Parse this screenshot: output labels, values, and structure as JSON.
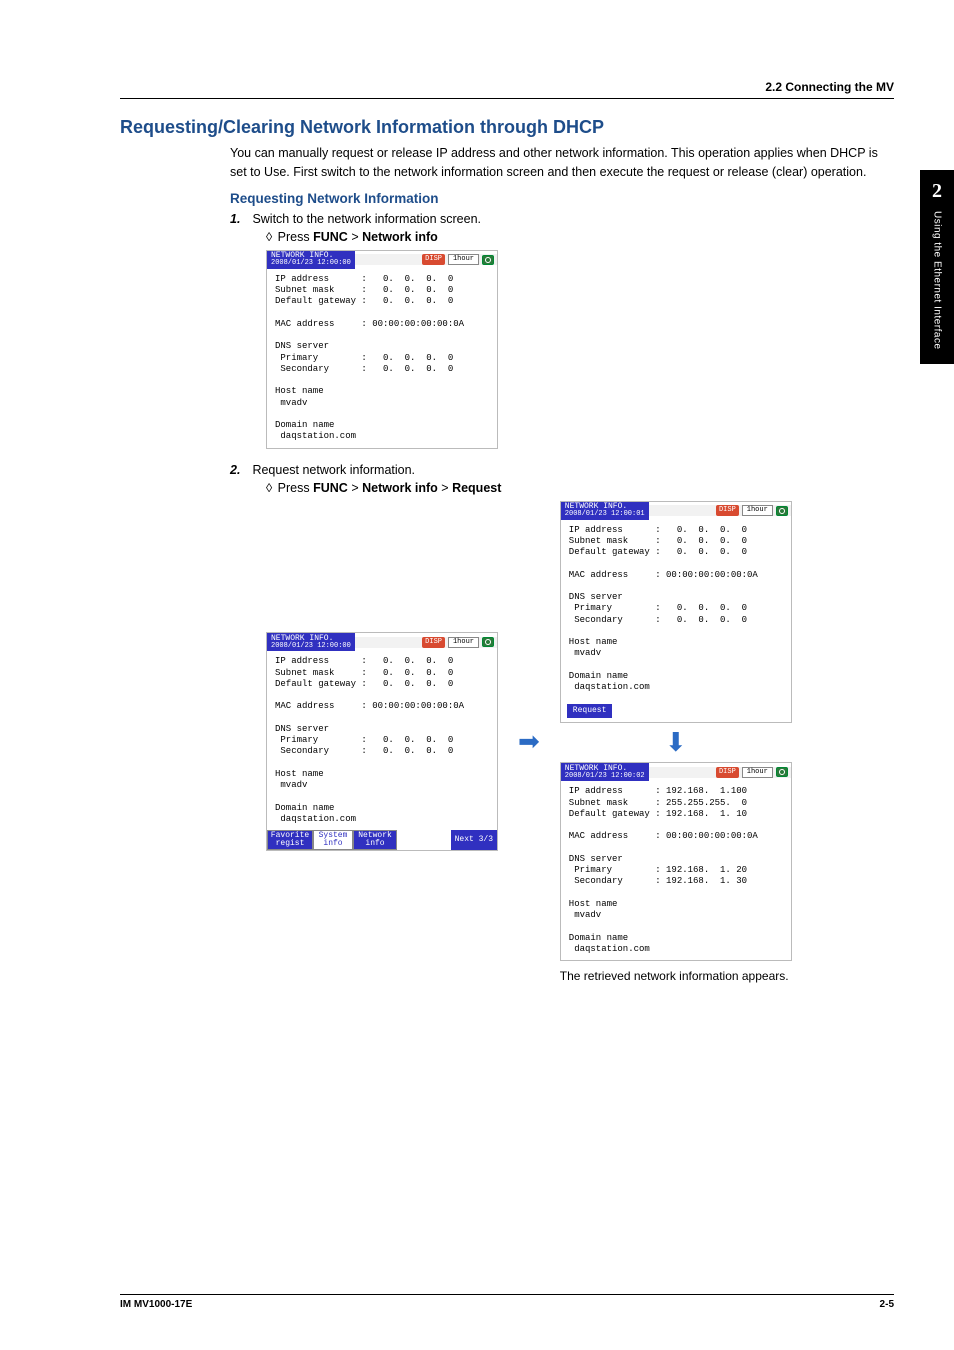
{
  "header": {
    "section": "2.2  Connecting the MV"
  },
  "title": "Requesting/Clearing Network Information through DHCP",
  "intro": "You can manually request or release IP address and other network information. This operation applies when DHCP is set to Use. First switch to the network information screen and then execute the request or release (clear) operation.",
  "sub1": "Requesting Network Information",
  "step1": {
    "num": "1.",
    "text": "Switch to the network information screen."
  },
  "bc1": {
    "prefix": "◊ Press ",
    "a": "FUNC",
    "sep": " > ",
    "b": "Network info"
  },
  "step2": {
    "num": "2.",
    "text": "Request network information."
  },
  "bc2": {
    "prefix": "◊ Press ",
    "a": "FUNC",
    "sep": " > ",
    "b": "Network info",
    "c": "Request"
  },
  "screen_zero": {
    "title": "NETWORK INFO.",
    "ts": "2008/01/23 12:00:00",
    "disp": "DISP",
    "hour": "1hour",
    "body": "IP address      :   0.  0.  0.  0\nSubnet mask     :   0.  0.  0.  0\nDefault gateway :   0.  0.  0.  0\n\nMAC address     : 00:00:00:00:00:0A\n\nDNS server\n Primary        :   0.  0.  0.  0\n Secondary      :   0.  0.  0.  0\n\nHost name\n mvadv\n\nDomain name\n daqstation.com"
  },
  "screen_zero_menu": {
    "ts": "2008/01/23 12:00:00",
    "btn1a": "Favorite",
    "btn1b": "regist",
    "btn2a": "System",
    "btn2b": "info",
    "btn3a": "Network",
    "btn3b": "info",
    "next": "Next 3/3"
  },
  "screen_zero_req": {
    "ts": "2008/01/23 12:00:01",
    "request": "Request"
  },
  "screen_filled": {
    "ts": "2008/01/23 12:00:02",
    "body": "IP address      : 192.168.  1.100\nSubnet mask     : 255.255.255.  0\nDefault gateway : 192.168.  1. 10\n\nMAC address     : 00:00:00:00:00:0A\n\nDNS server\n Primary        : 192.168.  1. 20\n Secondary      : 192.168.  1. 30\n\nHost name\n mvadv\n\nDomain name\n daqstation.com"
  },
  "caption": "The retrieved network information appears.",
  "chapter": {
    "num": "2",
    "text": "Using the Ethernet Interface"
  },
  "footer": {
    "left": "IM MV1000-17E",
    "right": "2-5"
  }
}
